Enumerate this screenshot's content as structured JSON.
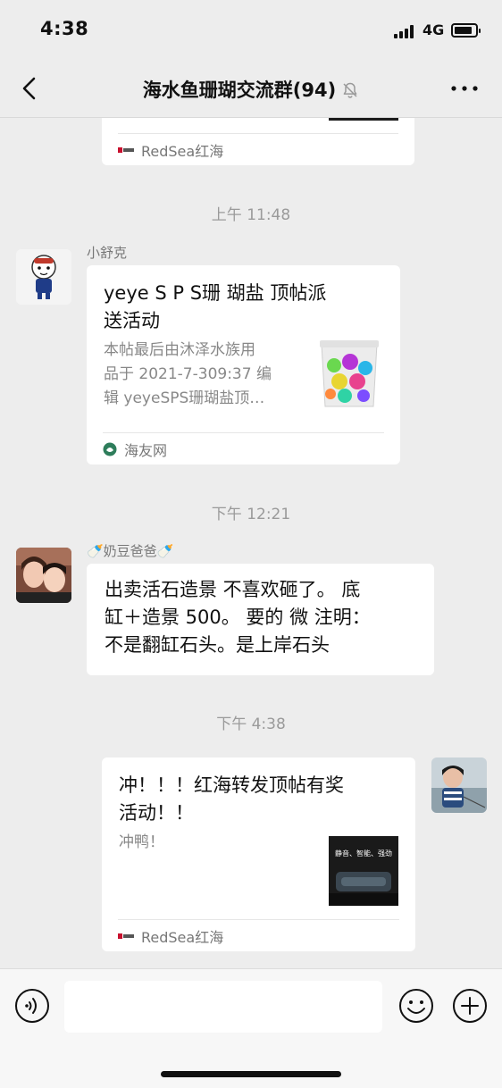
{
  "status_bar": {
    "time": "4:38",
    "network": "4G"
  },
  "nav": {
    "title": "海水鱼珊瑚交流群(94)"
  },
  "messages": [
    {
      "type": "card-partial",
      "source": "RedSea红海"
    },
    {
      "type": "timestamp",
      "text": "上午 11:48"
    },
    {
      "type": "card",
      "sender": "小舒克",
      "title": "yeye S P S珊 瑚盐 顶帖派送活动",
      "title_lines": [
        "yeye S P S珊 瑚盐 顶帖派",
        "送活动"
      ],
      "desc": "本帖最后由沐泽水族用品于 2021-7-309:37 编辑 yeyeSPS珊瑚盐顶…",
      "desc_lines": [
        "本帖最后由沐泽水族用",
        "品于 2021-7-309:37 编",
        "辑 yeyeSPS珊瑚盐顶…"
      ],
      "source": "海友网"
    },
    {
      "type": "timestamp",
      "text": "下午 12:21"
    },
    {
      "type": "text",
      "sender": "🍼奶豆爸爸🍼",
      "text": "出卖活石造景 不喜欢砸了。 底缸＋造景 500。 要的 微 注明：不是翻缸石头。是上岸石头",
      "lines": [
        "出卖活石造景 不喜欢砸了。 底",
        "缸＋造景 500。 要的 微 注明：",
        "不是翻缸石头。是上岸石头"
      ]
    },
    {
      "type": "timestamp",
      "text": "下午 4:38"
    },
    {
      "type": "card-self",
      "title": "冲！！！红海转发顶帖有奖活动！！",
      "title_lines": [
        "冲！！！红海转发顶帖有奖",
        "活动！！"
      ],
      "desc": "冲鸭！",
      "thumb_caption": "静音、智能、强劲",
      "source": "RedSea红海"
    }
  ],
  "input": {
    "placeholder": ""
  },
  "colors": {
    "background": "#ededed",
    "bubble": "#ffffff",
    "muted_text": "#9a9a9a"
  },
  "icons": [
    "back-icon",
    "mute-icon",
    "more-icon",
    "voice-icon",
    "emoji-icon",
    "plus-icon"
  ]
}
